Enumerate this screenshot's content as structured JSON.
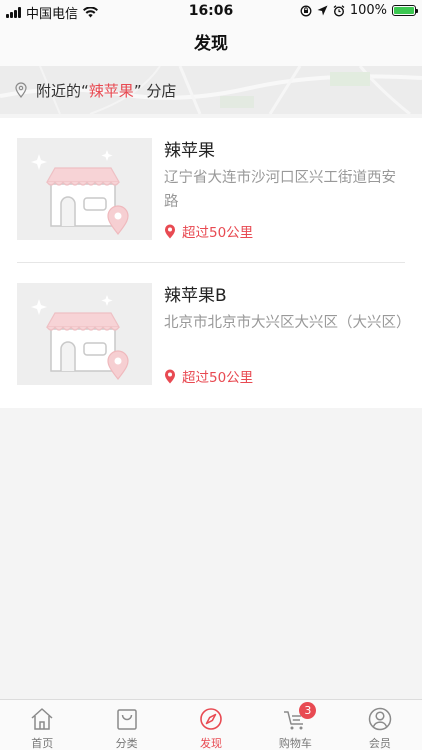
{
  "status_bar": {
    "carrier": "中国电信",
    "time": "16:06",
    "battery": "100%"
  },
  "nav": {
    "title": "发现"
  },
  "banner": {
    "prefix": "附近的",
    "open_quote": "“",
    "brand": "辣苹果",
    "close_quote": "”",
    "suffix": "分店"
  },
  "stores": [
    {
      "name": "辣苹果",
      "address": "辽宁省大连市沙河口区兴工街道西安路",
      "distance": "超过50公里"
    },
    {
      "name": "辣苹果B",
      "address": "北京市北京市大兴区大兴区（大兴区）",
      "distance": "超过50公里"
    }
  ],
  "tabs": [
    {
      "label": "首页",
      "icon": "home-icon"
    },
    {
      "label": "分类",
      "icon": "bag-icon"
    },
    {
      "label": "发现",
      "icon": "compass-icon",
      "active": true
    },
    {
      "label": "购物车",
      "icon": "cart-icon",
      "badge": "3"
    },
    {
      "label": "会员",
      "icon": "user-icon"
    }
  ],
  "colors": {
    "accent": "#e84a52",
    "battery": "#3cc751"
  }
}
